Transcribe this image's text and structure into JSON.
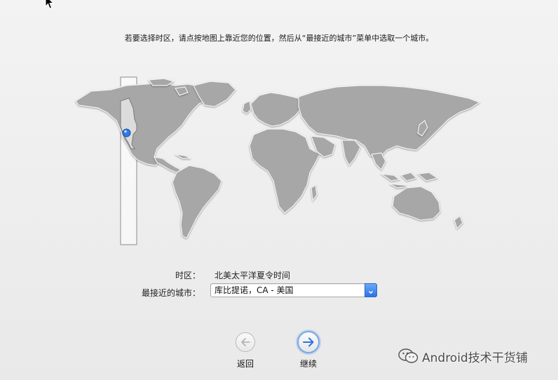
{
  "instruction": "若要选择时区，请点按地图上靠近您的位置，然后从“最接近的城市”菜单中选取一个城市。",
  "timezone": {
    "label": "时区：",
    "value": "北美太平洋夏令时间"
  },
  "closest_city": {
    "label": "最接近的城市：",
    "selected": "库比提诺，CA - 美国"
  },
  "buttons": {
    "back": "返回",
    "continue": "继续"
  },
  "watermark": {
    "text": "Android技术干货铺"
  },
  "colors": {
    "land": "#a7a7a7",
    "selected_zone": "#dcdcdc",
    "location_pin": "#2f7be8",
    "accent": "#2c74e6"
  },
  "icons": {
    "cursor": "arrow-cursor-icon",
    "pin": "location-pin-icon",
    "dropdown": "chevron-updown-icon",
    "back": "arrow-left-icon",
    "continue": "arrow-right-icon",
    "watermark": "wechat-icon"
  }
}
